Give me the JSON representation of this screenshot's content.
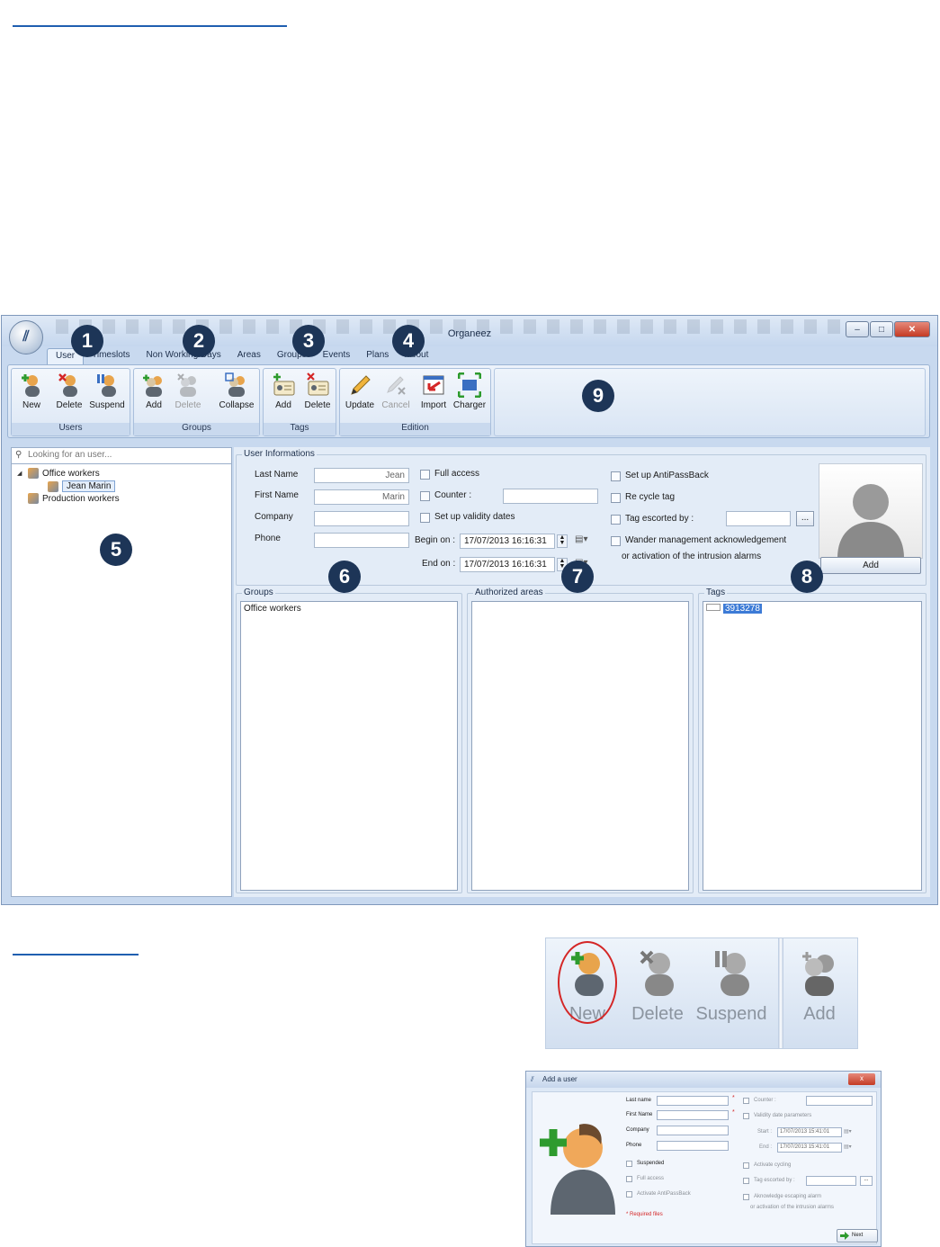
{
  "window": {
    "title": "Organeez",
    "controls": {
      "minimize": "–",
      "maximize": "□",
      "close": "✕"
    }
  },
  "tabs": [
    "User",
    "Timeslots",
    "Non Working Days",
    "Areas",
    "Groups",
    "Events",
    "Plans",
    "About"
  ],
  "ribbon": {
    "users": {
      "label": "Users",
      "new": "New",
      "delete": "Delete",
      "suspend": "Suspend"
    },
    "groups": {
      "label": "Groups",
      "add": "Add",
      "delete": "Delete",
      "collapse": "Collapse"
    },
    "tags": {
      "label": "Tags",
      "add": "Add",
      "delete": "Delete"
    },
    "edition": {
      "label": "Edition",
      "update": "Update",
      "cancel": "Cancel",
      "import": "Import",
      "charger": "Charger"
    }
  },
  "left_panel": {
    "search_placeholder": "Looking for an user...",
    "tree": {
      "group1": "Office workers",
      "user1": "Jean Marin",
      "group2": "Production workers"
    }
  },
  "user_info": {
    "legend": "User Informations",
    "last_name_label": "Last Name",
    "last_name_value": "Jean",
    "first_name_label": "First Name",
    "first_name_value": "Marin",
    "company_label": "Company",
    "company_value": "",
    "phone_label": "Phone",
    "phone_value": "",
    "full_access": "Full access",
    "counter": "Counter :",
    "validity_dates": "Set up validity dates",
    "begin_label": "Begin on :",
    "begin_value": "17/07/2013 16:16:31",
    "end_label": "End on :",
    "end_value": "17/07/2013 16:16:31",
    "antipassback": "Set up AntiPassBack",
    "recycle_tag": "Re cycle tag",
    "tag_escorted": "Tag escorted by :",
    "ellipsis": "...",
    "wander_line1": "Wander management acknowledgement",
    "wander_line2": "or activation of the intrusion alarms",
    "photo_add": "Add"
  },
  "lists": {
    "groups_legend": "Groups",
    "groups_items": [
      "Office workers"
    ],
    "areas_legend": "Authorized areas",
    "tags_legend": "Tags",
    "tags_items": [
      "3913278"
    ]
  },
  "badges": [
    "1",
    "2",
    "3",
    "4",
    "5",
    "6",
    "7",
    "8",
    "9"
  ],
  "zoom_crop": {
    "new": "New",
    "delete": "Delete",
    "suspend": "Suspend",
    "add": "Add"
  },
  "add_user_dialog": {
    "title": "Add a user",
    "close": "x",
    "last_name": "Last name",
    "first_name": "First Name",
    "company": "Company",
    "phone": "Phone",
    "suspended": "Suspended",
    "full_access": "Full access",
    "antipassback": "Activate AntiPassBack",
    "required": "* Required files",
    "counter": "Counter :",
    "validity": "Validity date parameters",
    "start_label": "Start :",
    "start_value": "17/07/2013 15:41:01",
    "end_label": "End :",
    "end_value": "17/07/2013 15:41:01",
    "activate_cycling": "Activate cycling",
    "tag_escorted": "Tag escorted by :",
    "ellipsis": "...",
    "acknowledge_line1": "Aknowledge escaping alarm",
    "acknowledge_line2": "or activation of the intrusion alarms",
    "next": "Next"
  },
  "colors": {
    "badge": "#1d3557",
    "accent": "#3d7bd6",
    "close": "#c43b24",
    "circle": "#d42626"
  },
  "icons": [
    "user-add-icon",
    "user-delete-icon",
    "user-suspend-icon",
    "group-add-icon",
    "group-delete-icon",
    "collapse-icon",
    "tag-add-icon",
    "tag-delete-icon",
    "pencil-icon",
    "cancel-icon",
    "import-icon",
    "charger-icon",
    "search-icon",
    "people-icon",
    "person-silhouette-icon",
    "calendar-icon"
  ]
}
